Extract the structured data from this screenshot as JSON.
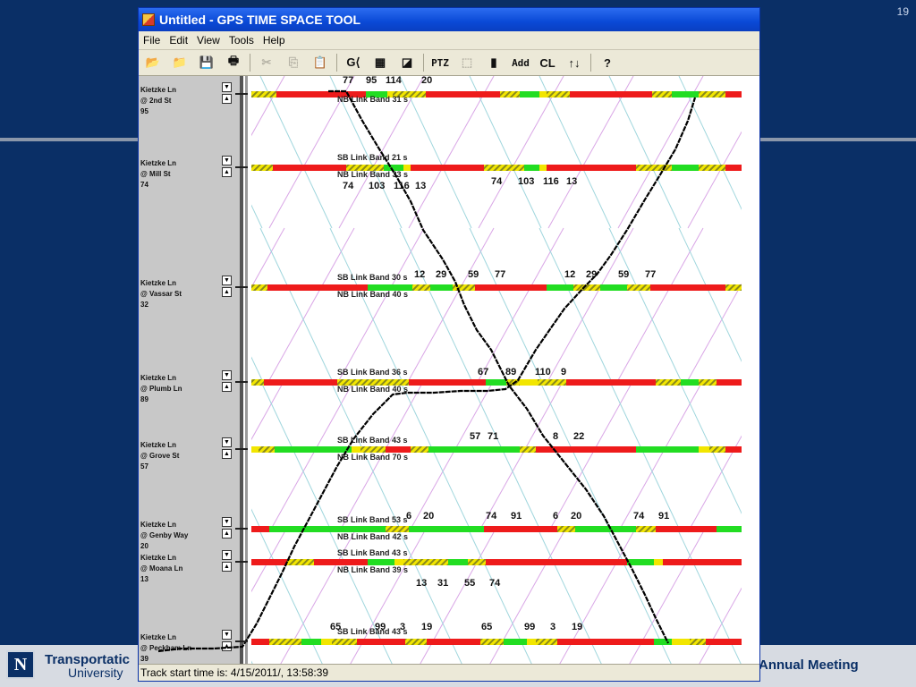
{
  "slide": {
    "number": "19",
    "footer_org_line1": "Transportatic",
    "footer_org_line2": "University",
    "footer_meeting": "Annual Meeting",
    "logo_letter": "N"
  },
  "window": {
    "title": "Untitled - GPS TIME SPACE TOOL"
  },
  "menu": [
    "File",
    "Edit",
    "View",
    "Tools",
    "Help"
  ],
  "toolbar": [
    {
      "name": "open-folder-icon",
      "glyph": "📂",
      "enabled": true
    },
    {
      "name": "open-file-icon",
      "glyph": "📁",
      "enabled": true
    },
    {
      "name": "save-icon",
      "glyph": "💾",
      "enabled": true
    },
    {
      "name": "print-icon",
      "glyph": "🖶",
      "enabled": true
    },
    {
      "sep": true
    },
    {
      "name": "cut-icon",
      "glyph": "✂",
      "enabled": false
    },
    {
      "name": "copy-icon",
      "glyph": "⎘",
      "enabled": false
    },
    {
      "name": "paste-icon",
      "glyph": "📋",
      "enabled": false
    },
    {
      "sep": true
    },
    {
      "name": "gps-icon",
      "glyph": "G⟨",
      "enabled": true
    },
    {
      "name": "table-icon",
      "glyph": "▦",
      "enabled": true
    },
    {
      "name": "diagonal-icon",
      "glyph": "◪",
      "enabled": true
    },
    {
      "sep": true
    },
    {
      "name": "ptz-icon",
      "glyph": "PTZ",
      "enabled": true
    },
    {
      "name": "select-icon",
      "glyph": "⬚",
      "enabled": false
    },
    {
      "name": "film-icon",
      "glyph": "▮",
      "enabled": true
    },
    {
      "name": "add-icon",
      "glyph": "Add",
      "enabled": true
    },
    {
      "name": "cl-icon",
      "glyph": "CL",
      "enabled": true
    },
    {
      "name": "sort-icon",
      "glyph": "↑↓",
      "enabled": true
    },
    {
      "sep": true
    },
    {
      "name": "help-icon",
      "glyph": "?",
      "enabled": true
    }
  ],
  "intersections": [
    {
      "line1": "Kietzke Ln",
      "line2": "@ 2nd St",
      "line3": "95"
    },
    {
      "line1": "Kietzke Ln",
      "line2": "@ Mill St",
      "line3": "74"
    },
    {
      "line1": "Kietzke Ln",
      "line2": "@ Vassar St",
      "line3": "32"
    },
    {
      "line1": "Kietzke Ln",
      "line2": "@ Plumb Ln",
      "line3": "89"
    },
    {
      "line1": "Kietzke Ln",
      "line2": "@ Grove St",
      "line3": "57"
    },
    {
      "line1": "Kietzke Ln",
      "line2": "@ Genby Way",
      "line3": "20"
    },
    {
      "line1": "Kietzke Ln",
      "line2": "@ Moana Ln",
      "line3": "13"
    },
    {
      "line1": "Kietzke Ln",
      "line2": "@ Peckham Ln",
      "line3": "39"
    }
  ],
  "band_labels": [
    "NB Link Band 31 s",
    "SB Link Band 21 s",
    "NB Link Band 33 s",
    "SB Link Band 30 s",
    "NB Link Band 40 s",
    "SB Link Band 36 s",
    "NB Link Band 40 s",
    "SB Link Band 43 s",
    "NB Link Band 70 s",
    "SB Link Band 53 s",
    "NB Link Band 42 s",
    "SB Link Band 43 s",
    "NB Link Band 39 s",
    "SB Link Band 43 s"
  ],
  "number_labels": [
    "77",
    "95",
    "114",
    "20",
    "74",
    "103",
    "116",
    "13",
    "74",
    "103",
    "116",
    "13",
    "12",
    "29",
    "59",
    "77",
    "12",
    "29",
    "59",
    "77",
    "67",
    "89",
    "110",
    "9",
    "57",
    "71",
    "8",
    "22",
    "6",
    "20",
    "74",
    "91",
    "6",
    "20",
    "74",
    "91",
    "13",
    "31",
    "55",
    "74",
    "65",
    "99",
    "3",
    "19",
    "65",
    "99",
    "3",
    "19"
  ],
  "colors": {
    "red": "#ee1b1b",
    "green": "#22dd22",
    "yellow": "#f2e600",
    "hatch": "#8a8a1a",
    "pink_lines": "#d9a6e6",
    "teal_lines": "#9fd6dd",
    "track": "#000000"
  },
  "status": {
    "text": "Track start time is: 4/15/2011/, 13:58:39"
  }
}
